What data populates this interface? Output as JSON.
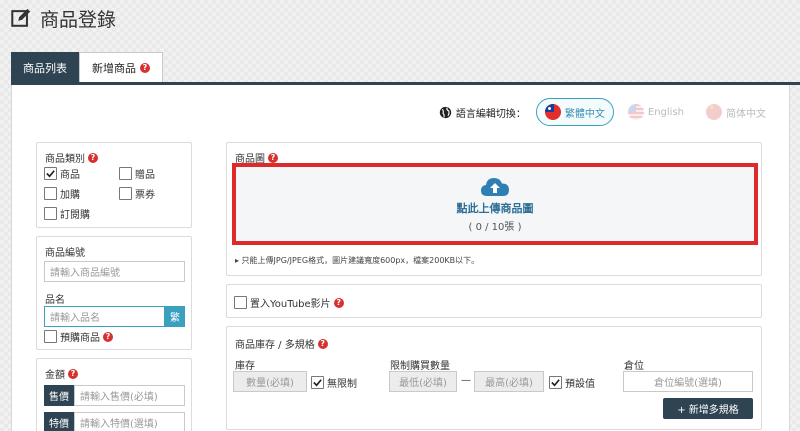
{
  "page": {
    "title": "商品登錄"
  },
  "tabs": [
    {
      "label": "商品列表"
    },
    {
      "label": "新增商品"
    }
  ],
  "help_glyph": "?",
  "language": {
    "label": "語言編輯切換：",
    "options": [
      {
        "label": "繁體中文",
        "active": true
      },
      {
        "label": "English",
        "active": false
      },
      {
        "label": "简体中文",
        "active": false
      }
    ]
  },
  "category": {
    "label": "商品類別",
    "options": [
      {
        "label": "商品",
        "checked": true
      },
      {
        "label": "贈品",
        "checked": false
      },
      {
        "label": "加購",
        "checked": false
      },
      {
        "label": "票券",
        "checked": false
      },
      {
        "label": "訂閱購",
        "checked": false
      }
    ]
  },
  "product_code": {
    "label": "商品編號",
    "placeholder": "請輸入商品編號"
  },
  "product_name": {
    "label": "品名",
    "placeholder": "請輸入品名",
    "lang_tag": "繁"
  },
  "preorder": {
    "label": "預購商品",
    "checked": false
  },
  "price": {
    "label": "金額",
    "sale_tag": "售價",
    "sale_placeholder": "請輸入售價(必填)",
    "special_tag": "特價",
    "special_placeholder": "請輸入特價(選填)"
  },
  "images": {
    "label": "商品圖",
    "upload_text": "點此上傳商品圖",
    "count_text": "( 0 / 10張 )",
    "note": "▸ 只能上傳JPG/JPEG格式，圖片建議寬度600px，檔案200KB以下。"
  },
  "youtube": {
    "label": "置入YouTube影片",
    "checked": false
  },
  "inventory": {
    "label": "商品庫存 / 多規格",
    "stock_label": "庫存",
    "stock_placeholder": "數量(必填)",
    "unlimited_label": "無限制",
    "limit_label": "限制購買數量",
    "min_placeholder": "最低(必填)",
    "dash": "—",
    "max_placeholder": "最高(必填)",
    "default_label": "預設值",
    "warehouse_label": "倉位",
    "warehouse_placeholder": "倉位編號(選填)",
    "add_spec_label": "+ 新增多規格"
  },
  "colors": {
    "navy": "#2f4453",
    "accent_red": "#dd2a2a",
    "accent_blue": "#3aa0bf",
    "help_red": "#d6312f"
  }
}
